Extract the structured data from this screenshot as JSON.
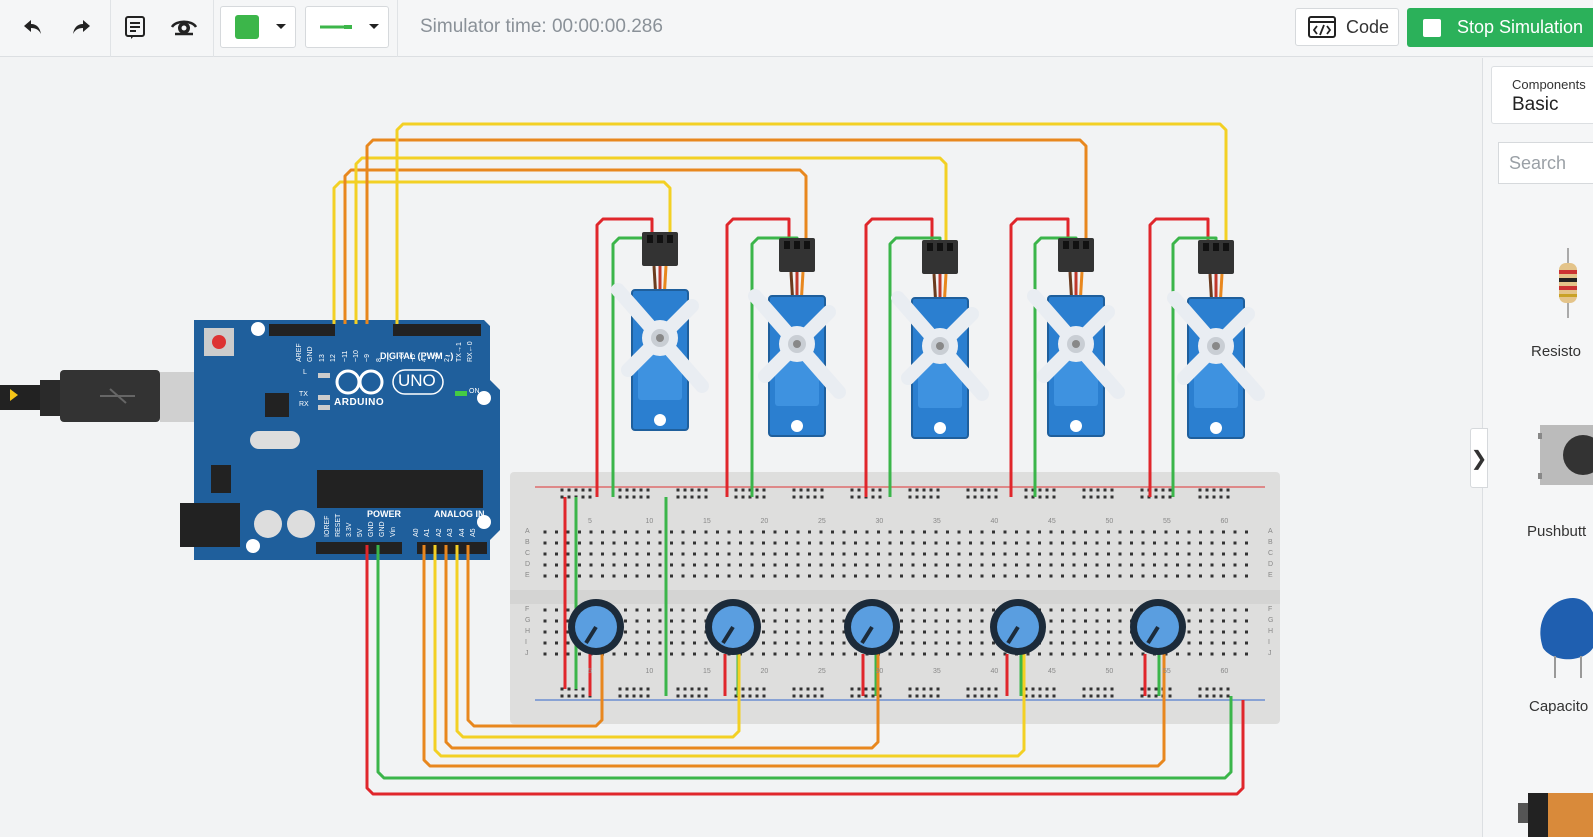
{
  "toolbar": {
    "undo_icon": "undo-icon",
    "redo_icon": "redo-icon",
    "notes_icon": "notes-icon",
    "visibility_icon": "eye-icon",
    "fill_color": "#3cb64a",
    "wire_color": "#3cb64a",
    "simulator_time": "Simulator time: 00:00:00.286",
    "code_label": "Code",
    "stop_label": "Stop Simulation",
    "stop_color": "#2bb15a"
  },
  "sidebar": {
    "components_label": "Components",
    "components_value": "Basic",
    "search_placeholder": "Search",
    "items": [
      {
        "label": "Resisto",
        "icon": "resistor-icon"
      },
      {
        "label": "Pushbutt",
        "icon": "pushbutton-icon"
      },
      {
        "label": "Capacito",
        "icon": "capacitor-icon"
      },
      {
        "label": "",
        "icon": "battery-icon"
      }
    ],
    "collapse_glyph": "❯"
  },
  "arduino": {
    "brand": "ARDUINO",
    "model": "UNO",
    "digital_label": "DIGITAL (PWM ~)",
    "power_label": "POWER",
    "analog_label": "ANALOG IN",
    "on_label": "ON",
    "led_l": "L",
    "led_tx": "TX",
    "led_rx": "RX",
    "digital_pins": [
      "AREF",
      "GND",
      "13",
      "12",
      "~11",
      "~10",
      "~9",
      "8",
      "7",
      "~6",
      "~5",
      "4",
      "~3",
      "2",
      "TX→1",
      "RX←0"
    ],
    "power_pins": [
      "IOREF",
      "RESET",
      "3.3V",
      "5V",
      "GND",
      "GND",
      "Vin"
    ],
    "analog_pins": [
      "A0",
      "A1",
      "A2",
      "A3",
      "A4",
      "A5"
    ],
    "board_color": "#1f5f9c"
  },
  "breadboard": {
    "column_numbers": [
      "5",
      "10",
      "15",
      "20",
      "25",
      "30",
      "35",
      "40",
      "45",
      "50",
      "55",
      "60"
    ],
    "row_letters_top": [
      "A",
      "B",
      "C",
      "D",
      "E"
    ],
    "row_letters_bottom": [
      "F",
      "G",
      "H",
      "I",
      "J"
    ]
  },
  "servo_count": 5,
  "pot_count": 5
}
